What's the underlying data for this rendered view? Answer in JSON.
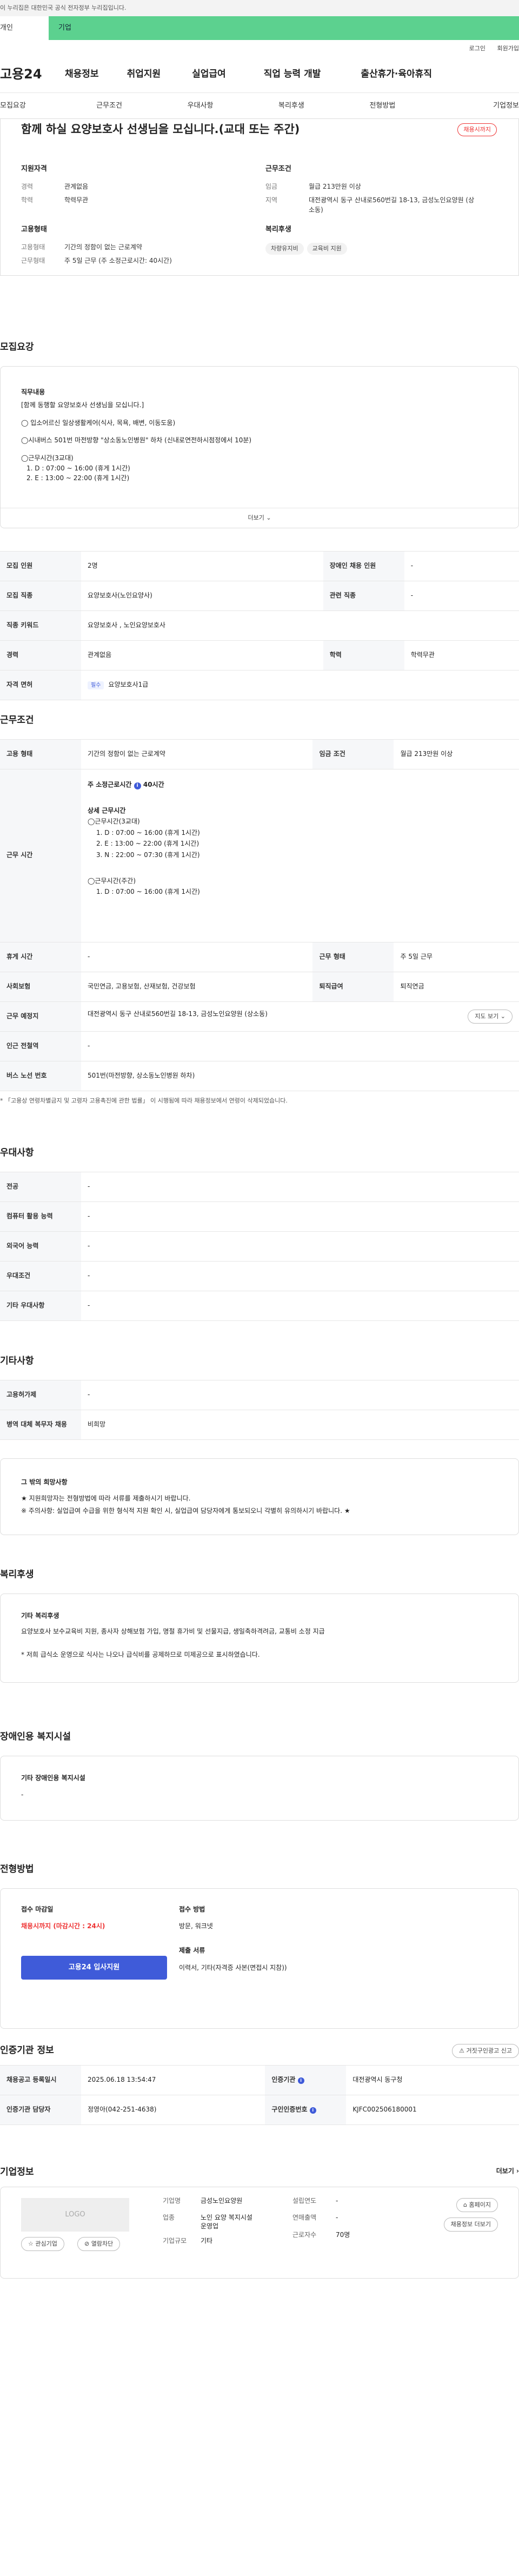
{
  "gov_banner": "이 누리집은 대한민국 공식 전자정부 누리집입니다.",
  "user_tabs": {
    "individual": "개인",
    "corporate": "기업"
  },
  "util": {
    "login": "로그인",
    "signup": "회원가입"
  },
  "gnb": {
    "logo": "고용24",
    "items": [
      "채용정보",
      "취업지원",
      "실업급여",
      "직업 능력 개발",
      "출산휴가·육아휴직"
    ]
  },
  "snb": [
    "모집요강",
    "근무조건",
    "우대사항",
    "복리후생",
    "전형방법",
    "기업정보"
  ],
  "summary": {
    "title": "함께 하실 요양보호사 선생님을 모십니다.(교대 또는 주간)",
    "status_badge": "채용시까지",
    "qual": {
      "heading": "지원자격",
      "rows": [
        {
          "k": "경력",
          "v": "관계없음"
        },
        {
          "k": "학력",
          "v": "학력무관"
        }
      ]
    },
    "work": {
      "heading": "근무조건",
      "rows": [
        {
          "k": "임금",
          "v": "월급 213만원 이상"
        },
        {
          "k": "지역",
          "v": "대전광역시 동구 산내로560번길 18-13, 금성노인요양원 (상소동)"
        }
      ]
    },
    "employ": {
      "heading": "고용형태",
      "rows": [
        {
          "k": "고용형태",
          "v": "기간의 정함이 없는 근로계약"
        },
        {
          "k": "근무형태",
          "v": "주 5일 근무 (주 소정근로시간: 40시간)"
        }
      ]
    },
    "welfare": {
      "heading": "복리후생",
      "chips": [
        "차량유지비",
        "교육비 지원"
      ]
    }
  },
  "recruit": {
    "heading": "모집요강",
    "duty_label": "직무내용",
    "duty_lines": [
      "[함께 동행할 요양보호사 선생님을 모십니다.]",
      "◯ 입소어르신 일상생활케어(식사, 목욕, 배변, 이동도움)",
      "◯시내버스 501번 마전방향 \"상소동노인병원\" 하차 (신내로연전하시점정에서 10분)",
      "◯근무시간(3교대)",
      "1. D : 07:00 ~ 16:00 (휴게 1시간)",
      "2. E : 13:00 ~ 22:00 (휴게 1시간)"
    ],
    "more": "더보기",
    "table": {
      "r1": {
        "k1": "모집 인원",
        "v1": "2명",
        "k2": "장애인 채용 인원",
        "v2": "-"
      },
      "r2": {
        "k1": "모집 직종",
        "v1": "요양보호사(노인요양사)",
        "k2": "관련 직종",
        "v2": "-"
      },
      "r3": {
        "k1": "직종 키워드",
        "v1": "요양보호사 , 노인요양보호사"
      },
      "r4": {
        "k1": "경력",
        "v1": "관계없음",
        "k2": "학력",
        "v2": "학력무관"
      },
      "r5": {
        "k1": "자격 면허",
        "tag": "필수",
        "v1": "요양보호사1급"
      }
    }
  },
  "conditions": {
    "heading": "근무조건",
    "employ_type": {
      "k": "고용 형태",
      "v": "기간의 정함이 없는 근로계약",
      "k2": "임금 조건",
      "v2": "월급 213만원 이상"
    },
    "hours": {
      "k": "근무 시간",
      "week": "주 소정근로시간",
      "week_val": "40시간",
      "detail_label": "상세 근무시간",
      "lines1": [
        "◯근무시간(3교대)",
        "1. D : 07:00 ~ 16:00 (휴게 1시간)",
        "2. E : 13:00 ~ 22:00 (휴게 1시간)",
        "3. N : 22:00 ~ 07:30 (휴게 1시간)"
      ],
      "lines2": [
        "◯근무시간(주간)",
        "1. D : 07:00 ~ 16:00 (휴게 1시간)"
      ]
    },
    "rows": [
      {
        "k": "휴게 시간",
        "v": "-",
        "k2": "근무 형태",
        "v2": "주 5일 근무"
      },
      {
        "k": "사회보험",
        "v": "국민연금, 고용보험, 산재보험, 건강보험",
        "k2": "퇴직급여",
        "v2": "퇴직연금"
      },
      {
        "k": "근무 예정지",
        "v": "대전광역시 동구 산내로560번길 18-13, 금성노인요양원 (상소동)",
        "btn": "지도 보기"
      },
      {
        "k": "인근 전철역",
        "v": "-"
      },
      {
        "k": "버스 노선 번호",
        "v": "501번(마전방향, 상소동노인병원 하차)"
      }
    ],
    "footnote": "* 「고용상 연령차별금지 및 고령자 고용촉진에 관한 법률」 이 시행됨에 따라 채용정보에서 연령이 삭제되었습니다."
  },
  "preference": {
    "heading": "우대사항",
    "rows": [
      {
        "k": "전공",
        "v": "-"
      },
      {
        "k": "컴퓨터 활용 능력",
        "v": "-"
      },
      {
        "k": "외국어 능력",
        "v": "-"
      },
      {
        "k": "우대조건",
        "v": "-"
      },
      {
        "k": "기타 우대사항",
        "v": "-"
      }
    ]
  },
  "etc": {
    "heading": "기타사항",
    "rows": [
      {
        "k": "고용허가제",
        "v": "-"
      },
      {
        "k": "병역 대체 복무자 채용",
        "v": "비희망"
      }
    ],
    "other_label": "그 밖의 희망사항",
    "other_lines": [
      "★ 지원희망자는 전형방법에 따라 서류를 제출하시기 바랍니다.",
      "※ 주의사항: 실업급여 수급을 위한 형식적 지원 확인 시, 실업급여 담당자에게 통보되오니 각별히 유의하시기 바랍니다. ★"
    ]
  },
  "benefits": {
    "heading": "복리후생",
    "label": "기타 복리후생",
    "line1": "요양보호사 보수교육비 지원, 종사자 상해보험 가입, 명절 휴가비 및 선물지급, 생일축하격려금, 교통비 소정 지급",
    "line2": "* 저희 급식소 운영으로 식사는 나오나 급식비를 공제하므로 미제공으로 표시하였습니다."
  },
  "disabled": {
    "heading": "장애인용 복지시설",
    "label": "기타 장애인용 복지시설",
    "value": "-"
  },
  "selection": {
    "heading": "전형방법",
    "deadline_label": "접수 마감일",
    "deadline_value": "채용시까지 (마감시간 : 24시)",
    "apply_btn": "고용24 입사지원",
    "method_label": "접수 방법",
    "method_value": "방문, 워크넷",
    "docs_label": "제출 서류",
    "docs_value": "이력서, 기타(자격증 사본(면접시 지참))"
  },
  "agency": {
    "heading": "인증기관 정보",
    "report_btn": "거짓구인광고 신고",
    "r1": {
      "k1": "채용공고 등록일시",
      "v1": "2025.06.18 13:54:47",
      "k2": "인증기관",
      "v2": "대전광역시 동구청"
    },
    "r2": {
      "k1": "인증기관 담당자",
      "v1": "정영아(042-251-4638)",
      "k2": "구인인증번호",
      "v2": "KJFC002506180001"
    }
  },
  "company": {
    "heading": "기업정보",
    "more": "더보기",
    "logo": "LOGO",
    "fav_btn": "관심기업",
    "block_btn": "열람차단",
    "name_label": "기업명",
    "name_value": "금성노인요양원",
    "industry_label": "업종",
    "industry_value": "노인 요양 복지시설 운영업",
    "size_label": "기업규모",
    "size_value": "기타",
    "est_label": "설립연도",
    "est_value": "-",
    "rev_label": "연매출액",
    "rev_value": "-",
    "emp_label": "근로자수",
    "emp_value": "70명",
    "home_btn": "홈페이지",
    "jobs_btn": "채용정보 더보기"
  }
}
